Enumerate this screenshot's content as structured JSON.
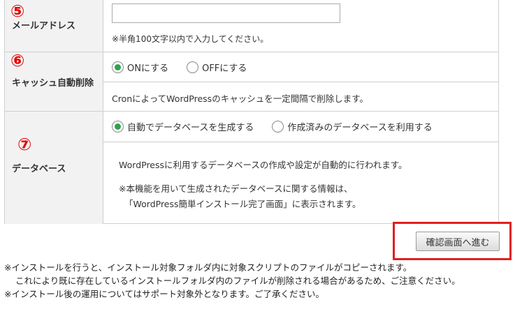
{
  "email_row": {
    "number": "⑤",
    "label": "メールアドレス",
    "input_value": "",
    "note": "※半角100文字以内で入力してください。"
  },
  "cache_row": {
    "number": "⑥",
    "label": "キャッシュ自動削除",
    "options": [
      "ONにする",
      "OFFにする"
    ],
    "selected": "ONにする",
    "description": "CronによってWordPressのキャッシュを一定間隔で削除します。"
  },
  "database_row": {
    "number": "⑦",
    "label": "データベース",
    "options": [
      "自動でデータベースを生成する",
      "作成済みのデータベースを利用する"
    ],
    "selected": "自動でデータベースを生成する",
    "description": "WordPressに利用するデータベースの作成や設定が自動的に行われます。",
    "note_line1": "※本機能を用いて生成されたデータベースに関する情報は、",
    "note_line2": "「WordPress簡単インストール完了画面」に表示されます。"
  },
  "submit": {
    "label": "確認画面へ進む"
  },
  "footer": {
    "line1": "※インストールを行うと、インストール対象フォルダ内に対象スクリプトのファイルがコピーされます。",
    "line2": "これにより既に存在しているインストールフォルダ内のファイルが削除される場合があるため、ご注意ください。",
    "line3": "※インストール後の運用についてはサポート対象外となります。ご了承ください。"
  },
  "colors": {
    "annotation_red": "#e60000",
    "radio_checked": "#2da44e",
    "label_bg": "#f2f2f2"
  }
}
